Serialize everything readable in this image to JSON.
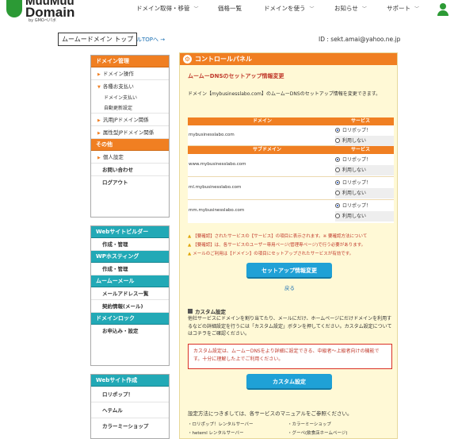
{
  "header": {
    "logo_line1": "MuuMuu",
    "logo_line2": "Domain",
    "logo_by": "by GMOペパボ",
    "nav": [
      "ドメイン取得・移管",
      "価格一覧",
      "ドメインを使う",
      "お知らせ",
      "サポート"
    ]
  },
  "tooltip": "ムームードメイン トップ",
  "topback": "ルTOPへ →",
  "user_id": "ID : sekt.amai@yahoo.ne.jp",
  "sidebar": {
    "domain_admin": {
      "heading": "ドメイン管理",
      "items": [
        "ドメイン操作",
        "各種お支払い"
      ],
      "subitems": [
        "ドメイン支払い",
        "自動更新設定"
      ],
      "items2": [
        "汎用JPドメイン関係",
        "属性型JPドメイン関係"
      ]
    },
    "others": {
      "heading": "その他",
      "items": [
        "個人設定",
        "お問い合わせ",
        "ログアウト"
      ]
    },
    "web_builder": {
      "heading": "Webサイトビルダー",
      "items": [
        "作成・管理"
      ]
    },
    "wp_hosting": {
      "heading": "WPホスティング",
      "items": [
        "作成・管理"
      ]
    },
    "muumuu_mail": {
      "heading": "ムームーメール",
      "items": [
        "メールアドレス一覧",
        "契約情報(メール)"
      ]
    },
    "domain_lock": {
      "heading": "ドメインロック",
      "items": [
        "お申込み・設定"
      ]
    },
    "web_create": {
      "heading": "Webサイト作成",
      "items": [
        "ロリポップ！",
        "ヘテムル",
        "カラーミーショップ"
      ]
    }
  },
  "panel": {
    "title": "コントロールパネル",
    "setup_title": "ムームーDNSのセットアップ情報変更",
    "intro": "ドメイン【mybusinesslabo.com】のムームーDNSのセットアップ情報を変更できます。",
    "table": {
      "col_domain": "ドメイン",
      "col_service": "サービス",
      "col_subdomain": "サブドメイン",
      "opt_lolipop": "ロリポップ！",
      "opt_none": "利用しない",
      "domain": "mybusinesslabo.com",
      "subdomains": [
        "www.mybusinesslabo.com",
        "ml.mybusinesslabo.com",
        "mm.mybusinesslabo.com"
      ]
    },
    "warnings": [
      "【要確認】されたサービスの【サービス】の項目に表示されます。※ 要確認方法について",
      "【要確認】は、各サービスのユーザー専用ページ(管理専ページ)で行う必要があります。",
      "メールのご利用は【ドメイン】の項目にセットアップされたサービスが有効です。"
    ],
    "setup_button": "セットアップ情報変更",
    "back": "戻る",
    "custom_title": "カスタム設定",
    "custom_text": "他社サービスにドメインを割り当てたり、メールにだけ、ホームページにだけドメインを利用するなどの詳細設定を行うには「カスタム設定」ボタンを押してください。カスタム設定についてはコチラをご確認ください。",
    "custom_warning": "カスタム設定は、ムームーDNSをより詳細に設定できる、中級者〜上級者向けの機能です。十分に理解した上でご利用ください。",
    "custom_button": "カスタム設定",
    "manual_text": "設定方法につきましては、各サービスのマニュアルをご参照ください。",
    "links": [
      "・ロリポップ！レンタルサーバー",
      "・カラーミーショップ",
      "・heteml レンタルサーバー",
      "・グーペ(飲食店ホームページ)"
    ]
  },
  "colors": {
    "orange": "#f07f22",
    "teal": "#22a9b6",
    "panel_bg": "#fff9d6",
    "button_blue": "#1fa1d6",
    "logo_green": "#2c9a35"
  }
}
